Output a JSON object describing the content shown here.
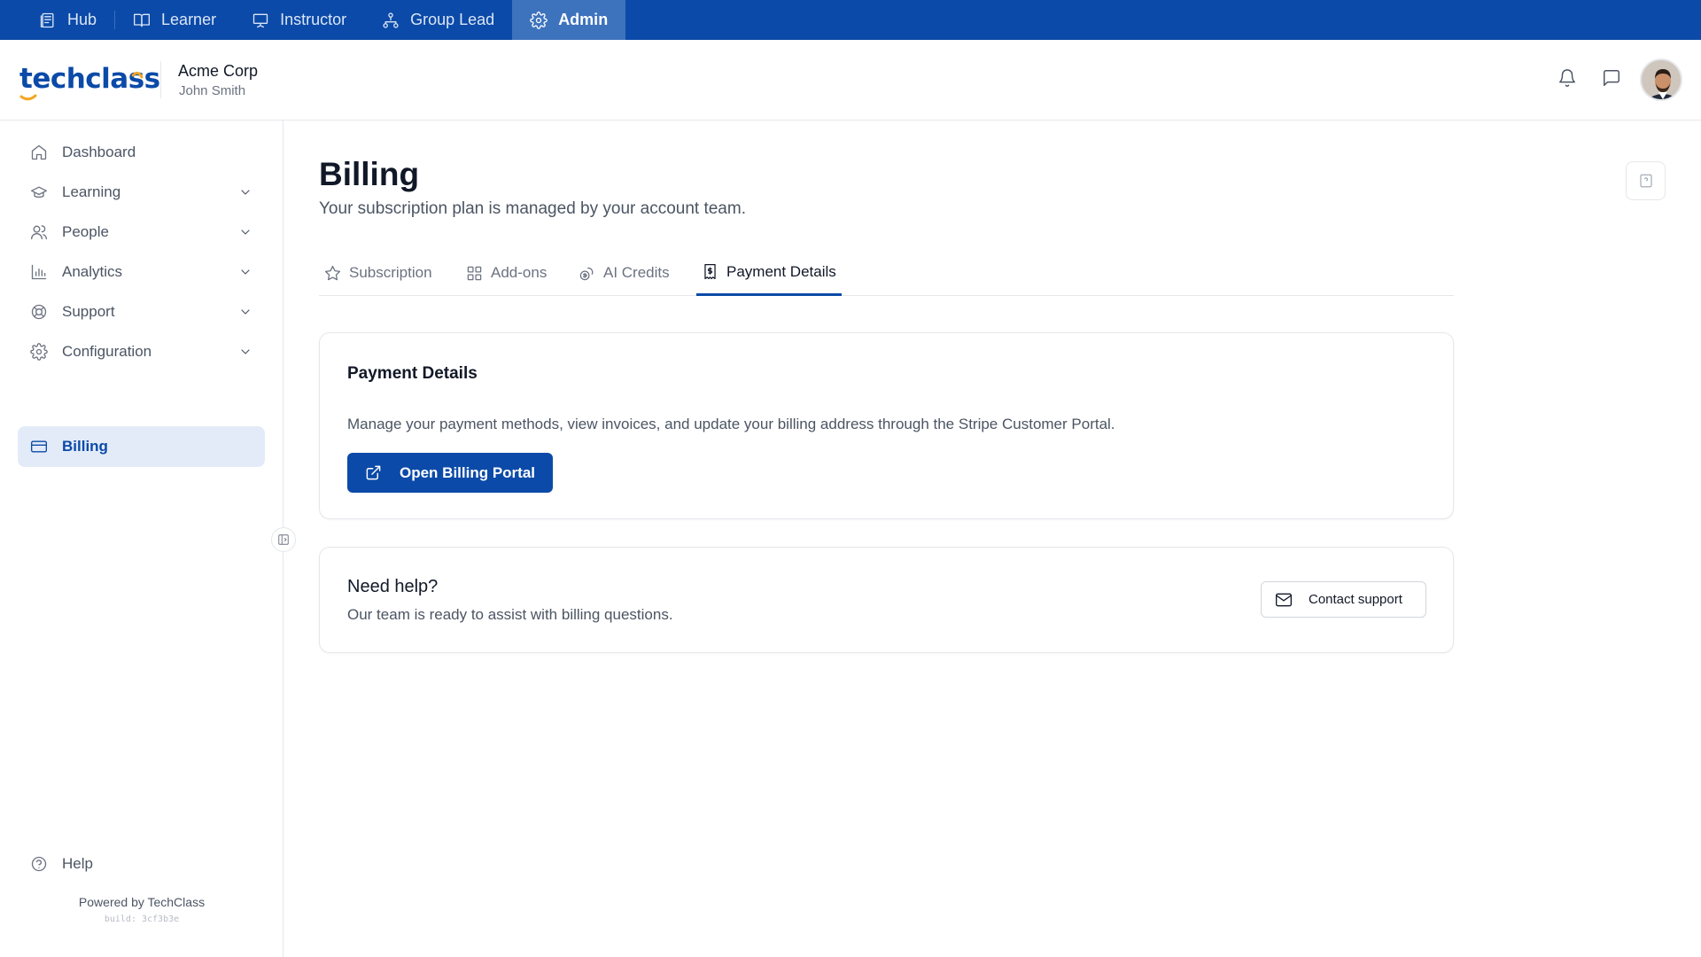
{
  "roles": [
    {
      "label": "Hub",
      "icon": "hub-icon",
      "active": false
    },
    {
      "label": "Learner",
      "icon": "book-icon",
      "active": false
    },
    {
      "label": "Instructor",
      "icon": "presentation-icon",
      "active": false
    },
    {
      "label": "Group Lead",
      "icon": "hierarchy-icon",
      "active": false
    },
    {
      "label": "Admin",
      "icon": "gear-icon",
      "active": true
    }
  ],
  "header": {
    "logo_text": "techclass",
    "org_name": "Acme Corp",
    "user_name": "John Smith"
  },
  "sidebar": {
    "items": [
      {
        "label": "Dashboard",
        "icon": "home-icon",
        "has_chevron": false
      },
      {
        "label": "Learning",
        "icon": "graduation-cap-icon",
        "has_chevron": true
      },
      {
        "label": "People",
        "icon": "users-icon",
        "has_chevron": true
      },
      {
        "label": "Analytics",
        "icon": "bar-chart-icon",
        "has_chevron": true
      },
      {
        "label": "Support",
        "icon": "lifebuoy-icon",
        "has_chevron": true
      },
      {
        "label": "Configuration",
        "icon": "gear-icon",
        "has_chevron": true
      },
      {
        "label": "Billing",
        "icon": "credit-card-icon",
        "has_chevron": false,
        "active": true
      }
    ],
    "help_label": "Help",
    "powered_by": "Powered by TechClass",
    "build": "build: 3cf3b3e"
  },
  "page": {
    "title": "Billing",
    "subtitle": "Your subscription plan is managed by your account team."
  },
  "tabs": [
    {
      "label": "Subscription",
      "icon": "star-icon",
      "active": false
    },
    {
      "label": "Add-ons",
      "icon": "grid-icon",
      "active": false
    },
    {
      "label": "AI Credits",
      "icon": "coins-icon",
      "active": false
    },
    {
      "label": "Payment Details",
      "icon": "receipt-icon",
      "active": true
    }
  ],
  "payment_card": {
    "title": "Payment Details",
    "description": "Manage your payment methods, view invoices, and update your billing address through the Stripe Customer Portal.",
    "button_label": "Open Billing Portal"
  },
  "help_card": {
    "title": "Need help?",
    "description": "Our team is ready to assist with billing questions.",
    "button_label": "Contact support"
  },
  "colors": {
    "brand": "#0b4aa8",
    "active_nav_bg": "#e3ebf8",
    "logo_accent": "#f5a623"
  }
}
